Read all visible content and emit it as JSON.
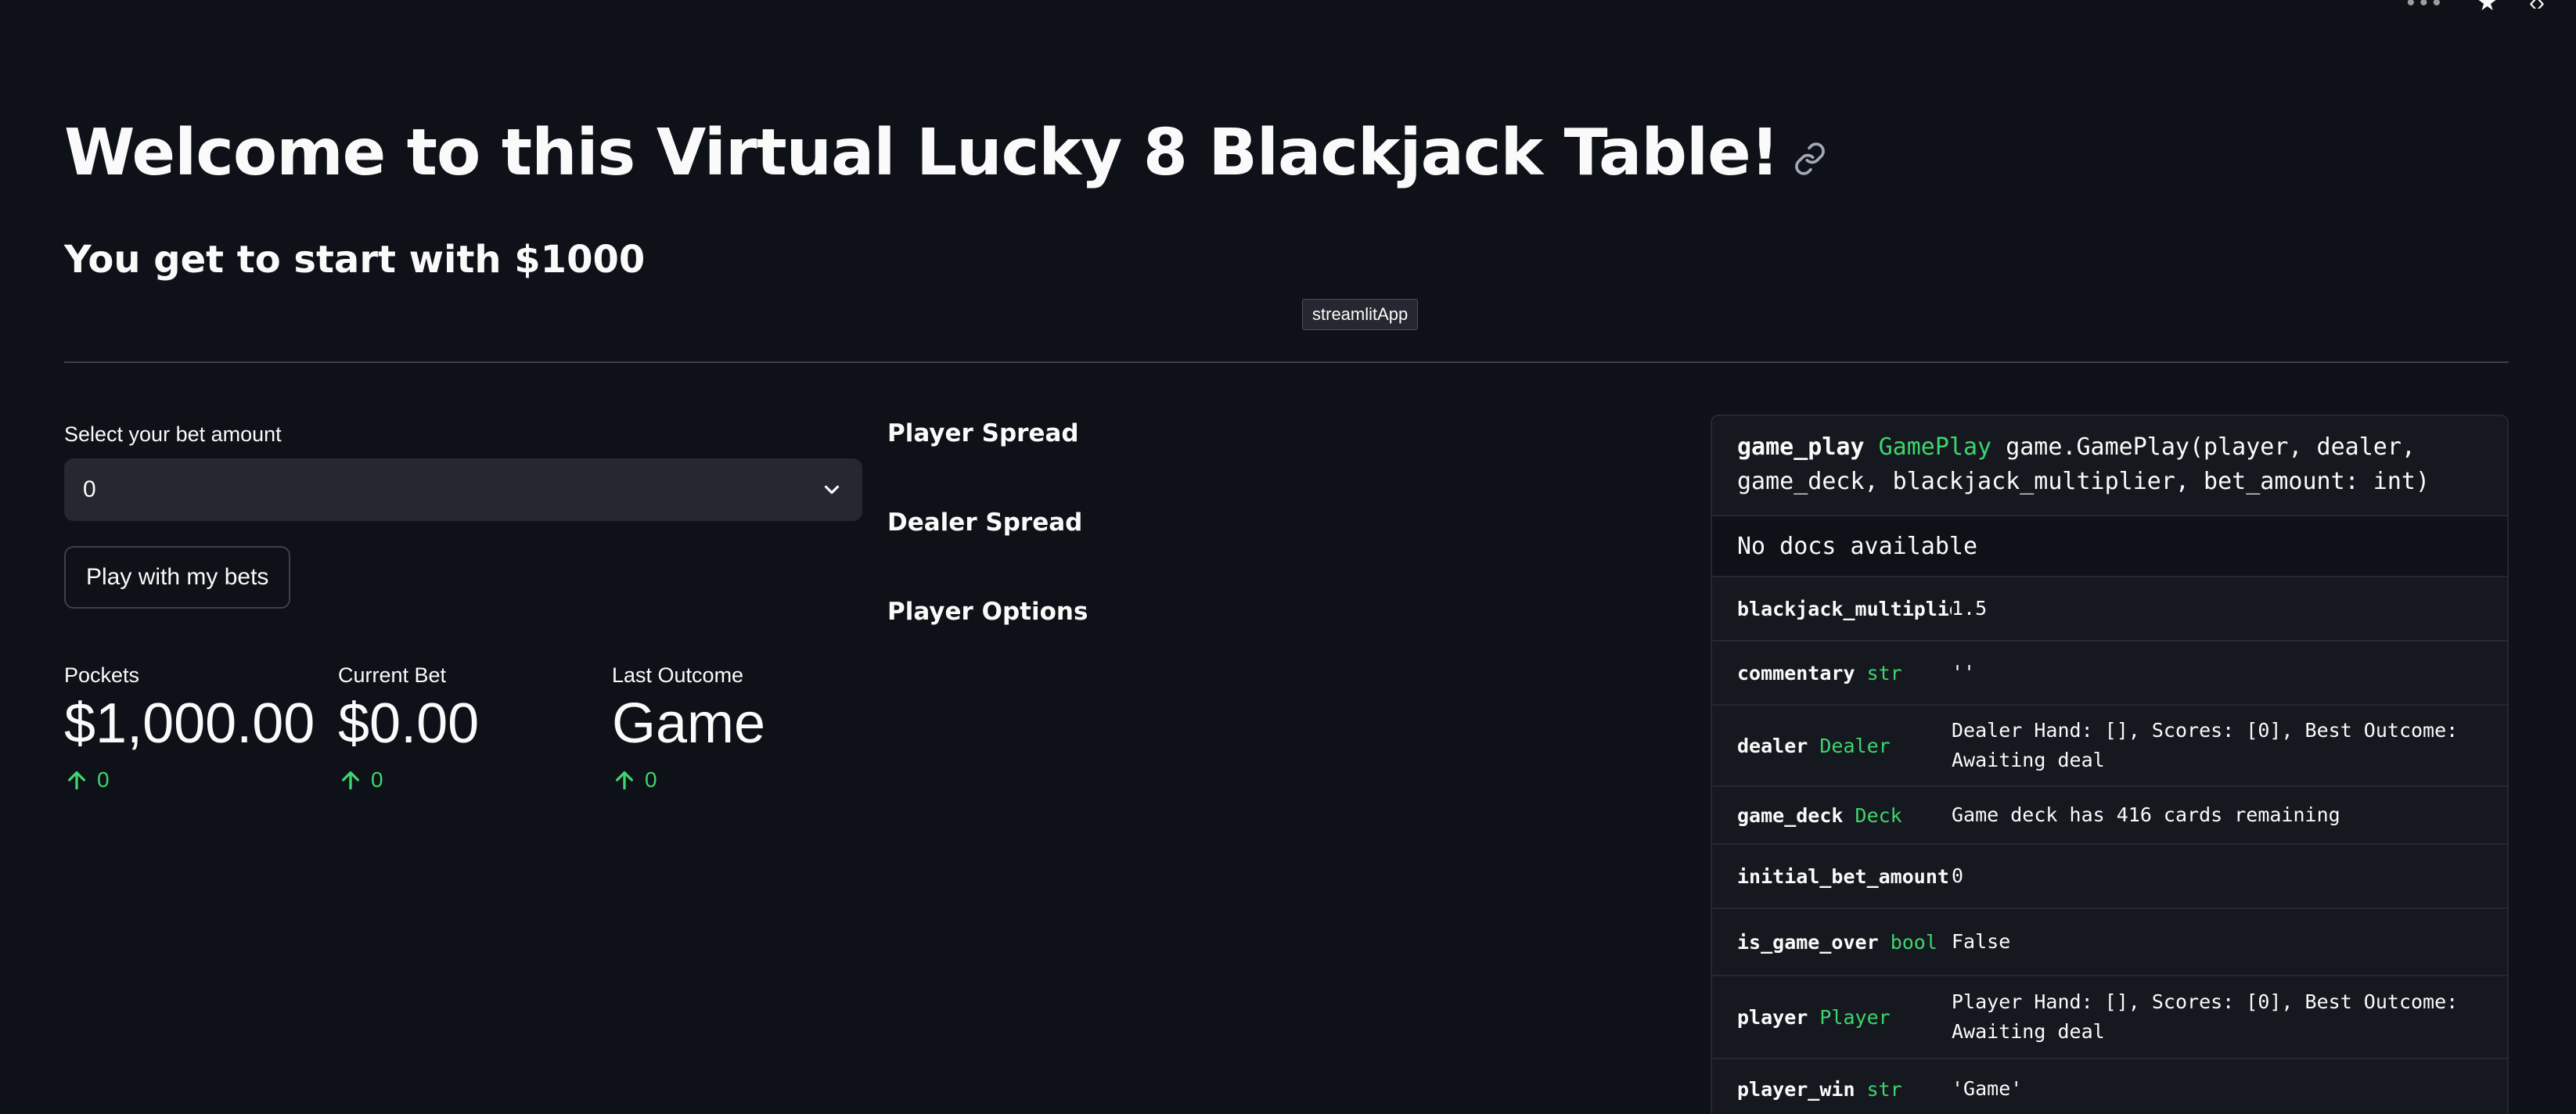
{
  "header": {
    "title": "Welcome to this Virtual Lucky 8 Blackjack Table!",
    "subtitle": "You get to start with $1000",
    "tooltip": "streamlitApp"
  },
  "controls": {
    "select_label": "Select your bet amount",
    "select_value": "0",
    "play_button": "Play with my bets"
  },
  "metrics": [
    {
      "label": "Pockets",
      "value": "$1,000.00",
      "delta": "0"
    },
    {
      "label": "Current Bet",
      "value": "$0.00",
      "delta": "0"
    },
    {
      "label": "Last Outcome",
      "value": "Game",
      "delta": "0"
    }
  ],
  "middle": {
    "player_spread": "Player Spread",
    "dealer_spread": "Dealer Spread",
    "player_options": "Player Options"
  },
  "inspector": {
    "name": "game_play",
    "type": "GamePlay",
    "signature_line1": "game.GamePlay(player, dealer,",
    "signature_line2": "game_deck, blackjack_multiplier, bet_amount: int)",
    "docs": "No docs available",
    "attributes": [
      {
        "name": "blackjack_multiplie",
        "type": "",
        "value": "1.5"
      },
      {
        "name": "commentary",
        "type": "str",
        "value": "''"
      },
      {
        "name": "dealer",
        "type": "Dealer",
        "value": "Dealer Hand: [], Scores: [0], Best Outcome: Awaiting deal"
      },
      {
        "name": "game_deck",
        "type": "Deck",
        "value": "Game deck has 416 cards remaining"
      },
      {
        "name": "initial_bet_amount",
        "type": "",
        "value": "0"
      },
      {
        "name": "is_game_over",
        "type": "bool",
        "value": "False"
      },
      {
        "name": "player",
        "type": "Player",
        "value": "Player Hand: [], Scores: [0], Best Outcome: Awaiting deal"
      },
      {
        "name": "player_win",
        "type": "str",
        "value": "'Game'"
      }
    ]
  },
  "colors": {
    "background": "#0e1117",
    "accent_green": "#3dd56d",
    "input_bg": "#262730"
  }
}
